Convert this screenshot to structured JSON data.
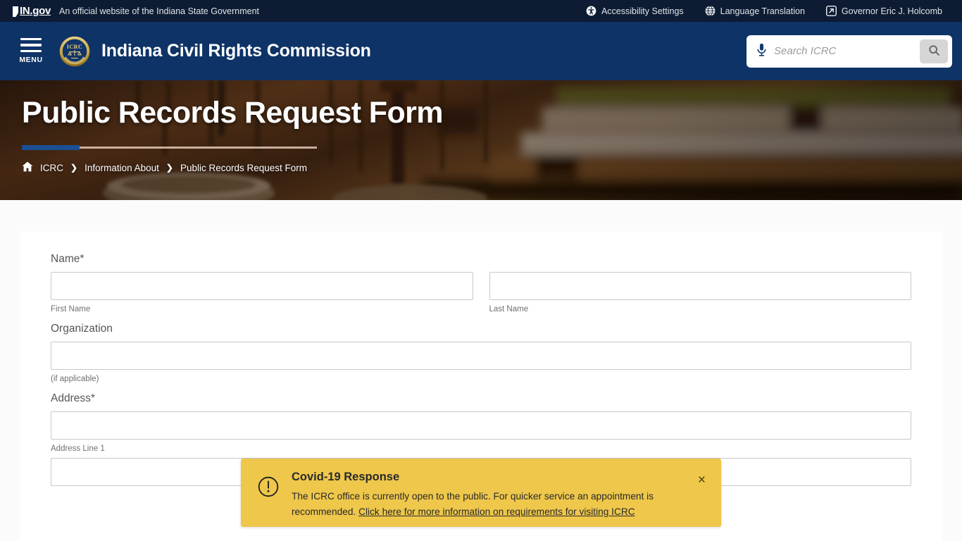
{
  "statebar": {
    "logo_in": "IN",
    "logo_dot_gov": ".gov",
    "tagline": "An official website of the Indiana State Government",
    "links": [
      {
        "label": "Accessibility Settings",
        "icon": "accessibility-icon"
      },
      {
        "label": "Language Translation",
        "icon": "globe-icon"
      },
      {
        "label": "Governor Eric J. Holcomb",
        "icon": "external-link-icon"
      }
    ]
  },
  "masthead": {
    "menu_label": "MENU",
    "site_title": "Indiana Civil Rights Commission",
    "seal_text": "ICRC",
    "seal_motto": "CIVIL RIGHTS COMMISSION",
    "brand_color": "#0e3366"
  },
  "search": {
    "placeholder": "Search ICRC",
    "value": "",
    "mic_icon": "microphone-icon",
    "submit_icon": "search-icon"
  },
  "hero": {
    "title": "Public Records Request Form",
    "accent_color": "#1b4f93"
  },
  "breadcrumb": {
    "home_icon": "home-icon",
    "separator": "❯",
    "items": [
      {
        "label": "ICRC",
        "current": false
      },
      {
        "label": "Information About",
        "current": false
      },
      {
        "label": "Public Records Request Form",
        "current": true
      }
    ]
  },
  "form": {
    "fields": [
      {
        "label": "Name",
        "required": true,
        "required_mark": "*",
        "inputs": [
          {
            "name": "first-name",
            "value": "",
            "sublabel": "First Name"
          },
          {
            "name": "last-name",
            "value": "",
            "sublabel": "Last Name"
          }
        ]
      },
      {
        "label": "Organization",
        "required": false,
        "required_mark": "",
        "inputs": [
          {
            "name": "organization",
            "value": "",
            "sublabel": "(if applicable)"
          }
        ]
      },
      {
        "label": "Address",
        "required": true,
        "required_mark": "*",
        "inputs": [
          {
            "name": "address-line-1",
            "value": "",
            "sublabel": "Address Line 1"
          },
          {
            "name": "address-line-2",
            "value": "",
            "sublabel": ""
          }
        ]
      }
    ]
  },
  "covid_banner": {
    "title": "Covid-19 Response",
    "body": "The ICRC office is currently open to the public. For quicker service an appointment is recommended. ",
    "link_text": "Click here for more information on requirements for visiting ICRC",
    "close_label": "×",
    "icon": "alert-circle-icon",
    "background_color": "#eec74b"
  }
}
